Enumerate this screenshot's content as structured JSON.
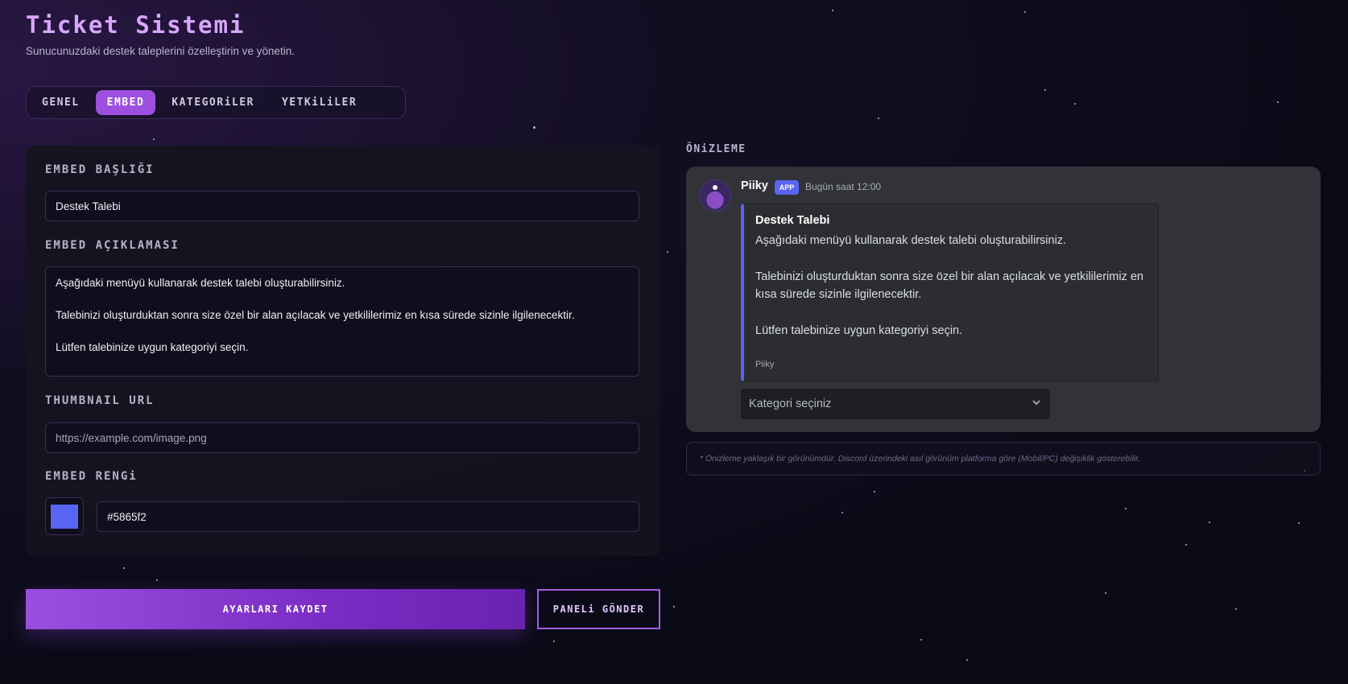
{
  "header": {
    "title": "Ticket Sistemi",
    "subtitle": "Sunucunuzdaki destek taleplerini özelleştirin ve yönetin."
  },
  "tabs": [
    {
      "label": "GENEL",
      "active": false
    },
    {
      "label": "EMBED",
      "active": true
    },
    {
      "label": "KATEGORiLER",
      "active": false
    },
    {
      "label": "YETKiLiLER",
      "active": false
    }
  ],
  "form": {
    "title_label": "EMBED BAŞLIĞI",
    "title_value": "Destek Talebi",
    "description_label": "EMBED AÇIKLAMASI",
    "description_lines": [
      "Aşağıdaki menüyü kullanarak destek talebi oluşturabilirsiniz.",
      "Talebinizi oluşturduktan sonra size özel bir alan açılacak ve yetkililerimiz en kısa sürede sizinle ilgilenecektir.",
      "Lütfen talebinize uygun kategoriyi seçin."
    ],
    "thumbnail_label": "THUMBNAIL URL",
    "thumbnail_placeholder": "https://example.com/image.png",
    "color_label": "EMBED RENGi",
    "color_value": "#5865f2"
  },
  "actions": {
    "save_label": "AYARLARI KAYDET",
    "send_label": "PANELi GÖNDER"
  },
  "preview": {
    "label": "ÖNiZLEME",
    "author": "Piiky",
    "badge": "APP",
    "timestamp": "Bugün saat 12:00",
    "embed_title": "Destek Talebi",
    "embed_lines": [
      "Aşağıdaki menüyü kullanarak destek talebi oluşturabilirsiniz.",
      "Talebinizi oluşturduktan sonra size özel bir alan açılacak ve yetkililerimiz en kısa sürede sizinle ilgilenecektir.",
      "Lütfen talebinize uygun kategoriyi seçin."
    ],
    "footer": "Piiky",
    "select_placeholder": "Kategori seçiniz",
    "note": "* Önizleme yaklaşık bir görünümdür. Discord üzerindeki asıl görünüm platforma göre (Mobil/PC) değişiklik gösterebilir."
  },
  "colors": {
    "accent": "#9d4fe0",
    "embed_color": "#5865f2",
    "title_color": "#d9a6ff"
  }
}
